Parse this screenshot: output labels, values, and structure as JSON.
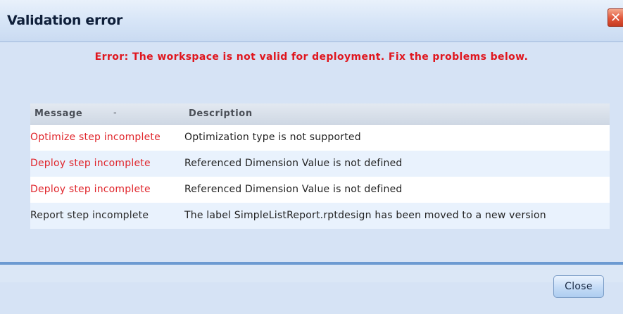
{
  "window": {
    "title": "Validation error",
    "close_glyph": "✕"
  },
  "error_message": "Error: The workspace is not valid for deployment. Fix the problems below.",
  "table": {
    "columns": {
      "message": "Message",
      "sort_indicator": "-",
      "description": "Description"
    },
    "rows": [
      {
        "message": "Optimize step incomplete",
        "description": "Optimization type  is not supported",
        "severity": "error"
      },
      {
        "message": "Deploy step incomplete",
        "description": "Referenced Dimension Value is not defined",
        "severity": "error"
      },
      {
        "message": "Deploy step incomplete",
        "description": "Referenced Dimension Value is not defined",
        "severity": "error"
      },
      {
        "message": "Report step incomplete",
        "description": "The label SimpleListReport.rptdesign has been moved to a new version",
        "severity": "info"
      }
    ]
  },
  "buttons": {
    "close_label": "Close"
  },
  "colors": {
    "error_text": "#e0161e",
    "dialog_background": "#d6e3f5",
    "separator": "#6c9ad1"
  }
}
